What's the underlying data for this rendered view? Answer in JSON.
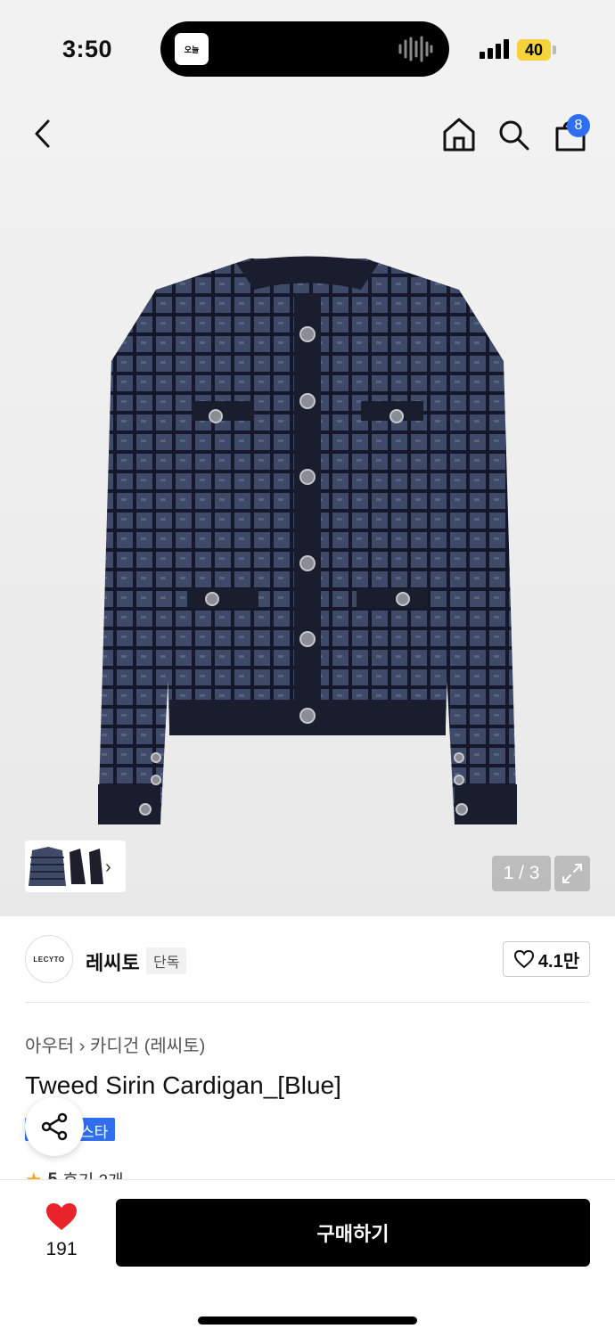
{
  "status_bar": {
    "time": "3:50",
    "battery": "40",
    "island_app_label": "오늘"
  },
  "header": {
    "cart_count": "8"
  },
  "gallery": {
    "pager": "1 / 3"
  },
  "brand": {
    "logo_text": "LECYTO",
    "name": "레씨토",
    "tag": "단독",
    "likes": "4.1만"
  },
  "product": {
    "breadcrumb": [
      "아우터",
      "카디건 (레씨토)"
    ],
    "title": "Tweed Sirin Cardigan_[Blue]",
    "badge": "스타",
    "rating": "5",
    "reviews": "후기 2개"
  },
  "bottom_bar": {
    "heart_count": "191",
    "buy_label": "구매하기"
  },
  "colors": {
    "accent_blue": "#2f6fef",
    "heart_red": "#e8232a",
    "battery_yellow": "#f5d33b"
  }
}
